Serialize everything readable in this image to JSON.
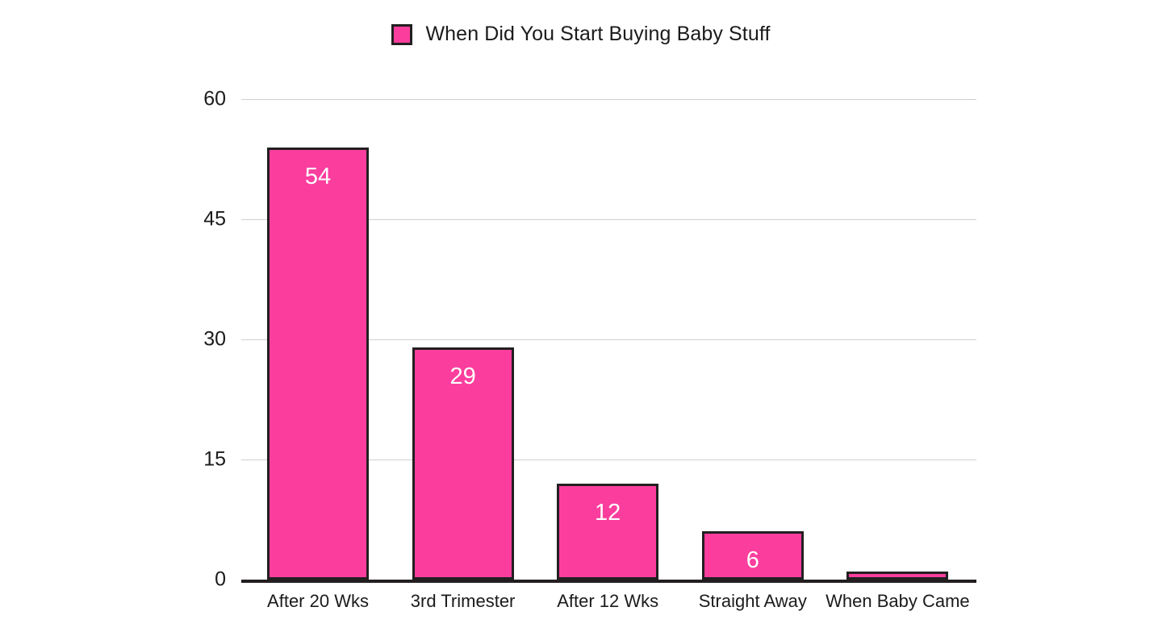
{
  "legend": {
    "label": "When Did You Start Buying Baby Stuff",
    "swatch_color": "#fb3e9e",
    "swatch_border_color": "#231f20",
    "position": "top-center"
  },
  "axes": {
    "y_ticks": [
      "60",
      "45",
      "30",
      "15",
      "0"
    ],
    "x_labels": [
      "After 20 Wks",
      "3rd Trimester",
      "After 12 Wks",
      "Straight Away",
      "When Baby Came"
    ]
  },
  "bars": [
    {
      "label": "After 20 Wks",
      "value": 54,
      "value_label": "54"
    },
    {
      "label": "3rd Trimester",
      "value": 29,
      "value_label": "29"
    },
    {
      "label": "After 12 Wks",
      "value": 12,
      "value_label": "12"
    },
    {
      "label": "Straight Away",
      "value": 6,
      "value_label": "6"
    },
    {
      "label": "When Baby Came",
      "value": 1,
      "value_label": ""
    }
  ],
  "colors": {
    "bar_fill": "#fb3e9e",
    "bar_border": "#231f20",
    "gridline": "#cfcfcf",
    "axis": "#231f20",
    "text": "#1b1b1b",
    "value_label": "#ffffff",
    "background": "#ffffff"
  },
  "chart_data": {
    "type": "bar",
    "title": "",
    "subtitle": "",
    "categories": [
      "After 20 Wks",
      "3rd Trimester",
      "After 12 Wks",
      "Straight Away",
      "When Baby Came"
    ],
    "values": [
      54,
      29,
      12,
      6,
      1
    ],
    "series": [
      {
        "name": "When Did You Start Buying Baby Stuff",
        "values": [
          54,
          29,
          12,
          6,
          1
        ],
        "color": "#fb3e9e"
      }
    ],
    "data_labels": [
      "54",
      "29",
      "12",
      "6",
      ""
    ],
    "xlabel": "",
    "ylabel": "",
    "ylim": [
      0,
      60
    ],
    "y_ticks": [
      0,
      15,
      30,
      45,
      60
    ],
    "grid": "horizontal",
    "legend_position": "top-center",
    "legend_entries": [
      "When Did You Start Buying Baby Stuff"
    ]
  }
}
